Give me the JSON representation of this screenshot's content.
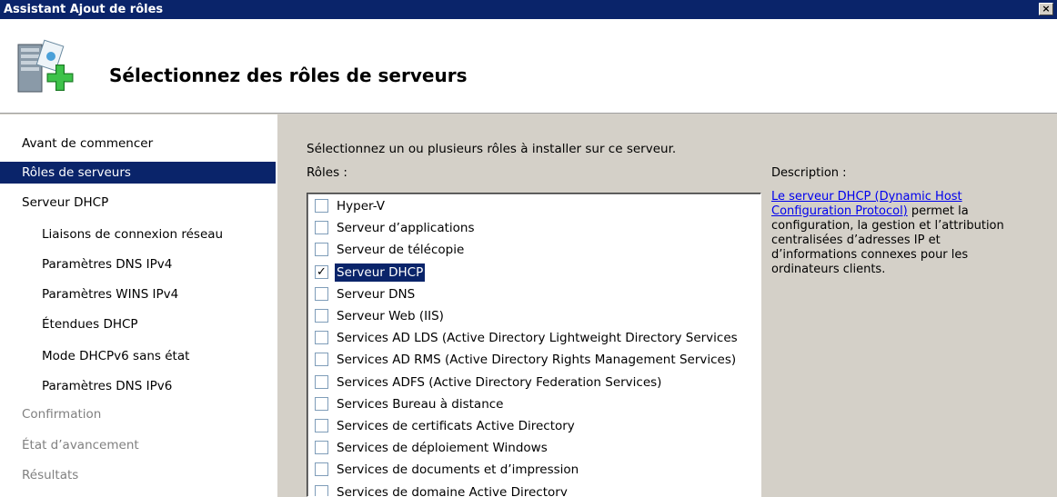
{
  "window": {
    "title": "Assistant Ajout de rôles",
    "close_label": "×"
  },
  "header": {
    "title": "Sélectionnez des rôles de serveurs"
  },
  "nav": {
    "items": [
      {
        "label": "Avant de commencer",
        "level": 0,
        "state": "normal"
      },
      {
        "label": "Rôles de serveurs",
        "level": 0,
        "state": "active"
      },
      {
        "label": "Serveur DHCP",
        "level": 0,
        "state": "normal"
      },
      {
        "label": "Liaisons de connexion réseau",
        "level": 1,
        "state": "normal"
      },
      {
        "label": "Paramètres DNS IPv4",
        "level": 1,
        "state": "normal"
      },
      {
        "label": "Paramètres WINS IPv4",
        "level": 1,
        "state": "normal"
      },
      {
        "label": "Étendues DHCP",
        "level": 1,
        "state": "normal"
      },
      {
        "label": "Mode DHCPv6 sans état",
        "level": 1,
        "state": "normal"
      },
      {
        "label": "Paramètres DNS IPv6",
        "level": 1,
        "state": "normal"
      },
      {
        "label": "Confirmation",
        "level": 0,
        "state": "disabled"
      },
      {
        "label": "État d’avancement",
        "level": 0,
        "state": "disabled"
      },
      {
        "label": "Résultats",
        "level": 0,
        "state": "disabled"
      }
    ]
  },
  "main": {
    "instruction": "Sélectionnez un ou plusieurs rôles à installer sur ce serveur.",
    "roles_label": "Rôles :",
    "roles": [
      {
        "label": "Hyper-V",
        "checked": false,
        "selected": false
      },
      {
        "label": "Serveur d’applications",
        "checked": false,
        "selected": false
      },
      {
        "label": "Serveur de télécopie",
        "checked": false,
        "selected": false
      },
      {
        "label": "Serveur DHCP",
        "checked": true,
        "selected": true
      },
      {
        "label": "Serveur DNS",
        "checked": false,
        "selected": false
      },
      {
        "label": "Serveur Web (IIS)",
        "checked": false,
        "selected": false
      },
      {
        "label": "Services AD LDS (Active Directory Lightweight Directory Services",
        "checked": false,
        "selected": false
      },
      {
        "label": "Services AD RMS (Active Directory Rights Management Services)",
        "checked": false,
        "selected": false
      },
      {
        "label": "Services ADFS (Active Directory Federation Services)",
        "checked": false,
        "selected": false
      },
      {
        "label": "Services Bureau à distance",
        "checked": false,
        "selected": false
      },
      {
        "label": "Services de certificats Active Directory",
        "checked": false,
        "selected": false
      },
      {
        "label": "Services de déploiement Windows",
        "checked": false,
        "selected": false
      },
      {
        "label": "Services de documents et d’impression",
        "checked": false,
        "selected": false
      },
      {
        "label": "Services de domaine Active Directory",
        "checked": false,
        "selected": false
      }
    ],
    "check_mark": "✓",
    "description": {
      "label": "Description :",
      "link_text": "Le serveur DHCP (Dynamic Host Configuration Protocol)",
      "text": " permet la configuration, la gestion et l’attribution centralisées d’adresses IP et d’informations connexes pour les ordinateurs clients."
    }
  },
  "icons": {
    "header_icon": "server-add-icon",
    "close": "close-icon"
  }
}
